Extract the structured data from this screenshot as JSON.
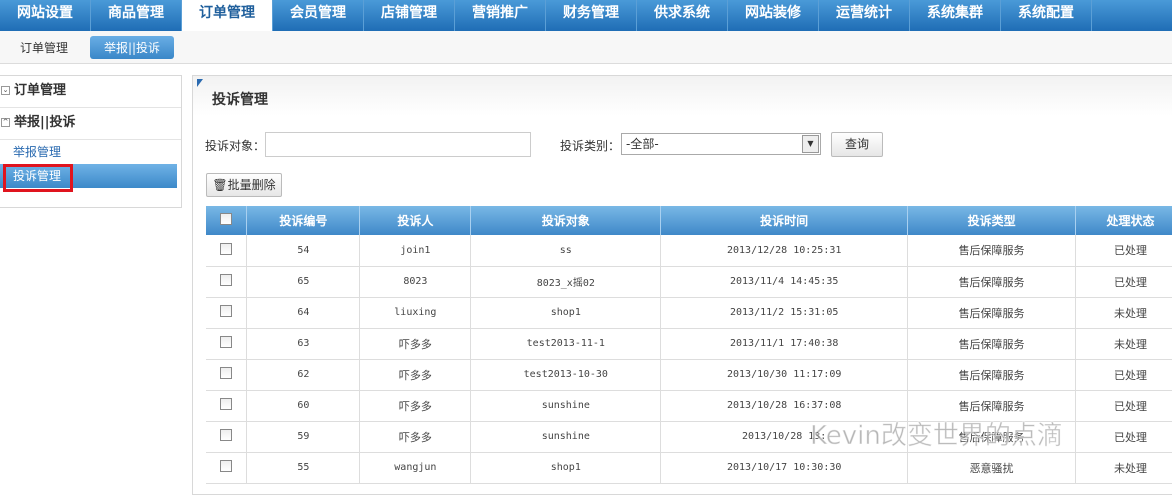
{
  "topnav": [
    "网站设置",
    "商品管理",
    "订单管理",
    "会员管理",
    "店铺管理",
    "营销推广",
    "财务管理",
    "供求系统",
    "网站装修",
    "运营统计",
    "系统集群",
    "系统配置"
  ],
  "subnav": [
    "订单管理",
    "举报||投诉"
  ],
  "sidebar": {
    "group1": "订单管理",
    "group2": "举报||投诉",
    "items": [
      "举报管理",
      "投诉管理"
    ]
  },
  "panel": {
    "title": "投诉管理",
    "target_label": "投诉对象：",
    "target_value": "",
    "type_label": "投诉类别：",
    "type_selected": "-全部-",
    "search_btn": "查询",
    "bulk_delete": "批量删除"
  },
  "table": {
    "headers": [
      "投诉编号",
      "投诉人",
      "投诉对象",
      "投诉时间",
      "投诉类型",
      "处理状态"
    ],
    "rows": [
      [
        "54",
        "join1",
        "ss",
        "2013/12/28 10:25:31",
        "售后保障服务",
        "已处理"
      ],
      [
        "65",
        "8023",
        "8023_x摇02",
        "2013/11/4 14:45:35",
        "售后保障服务",
        "已处理"
      ],
      [
        "64",
        "liuxing",
        "shop1",
        "2013/11/2 15:31:05",
        "售后保障服务",
        "未处理"
      ],
      [
        "63",
        "吓多多",
        "test2013-11-1",
        "2013/11/1 17:40:38",
        "售后保障服务",
        "未处理"
      ],
      [
        "62",
        "吓多多",
        "test2013-10-30",
        "2013/10/30 11:17:09",
        "售后保障服务",
        "已处理"
      ],
      [
        "60",
        "吓多多",
        "sunshine",
        "2013/10/28 16:37:08",
        "售后保障服务",
        "已处理"
      ],
      [
        "59",
        "吓多多",
        "sunshine",
        "2013/10/28 13:",
        "售后保障服务",
        "已处理"
      ],
      [
        "55",
        "wangjun",
        "shop1",
        "2013/10/17 10:30:30",
        "恶意骚扰",
        "未处理"
      ]
    ]
  },
  "watermark": "Kevin改变世界的点滴"
}
